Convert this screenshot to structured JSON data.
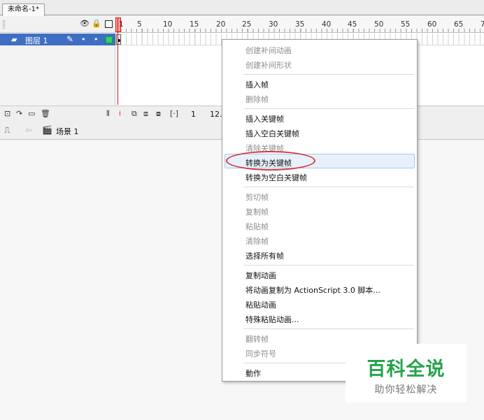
{
  "document_tab": {
    "label": "未命名-1*"
  },
  "timeline": {
    "ruler_numbers": [
      "1",
      "5",
      "10",
      "15",
      "20",
      "25",
      "30",
      "35",
      "40",
      "45",
      "50",
      "55",
      "60",
      "65",
      "7"
    ],
    "layer": {
      "name": "图层 1"
    },
    "bottom": {
      "frame": "1",
      "fps": "12."
    }
  },
  "editbar": {
    "scene": "场景 1"
  },
  "context_menu": {
    "items": [
      {
        "label": "创建补间动画",
        "enabled": false
      },
      {
        "label": "创建补间形状",
        "enabled": false
      },
      {
        "label": "插入帧",
        "enabled": true
      },
      {
        "label": "删除帧",
        "enabled": false
      },
      {
        "label": "插入关键帧",
        "enabled": true
      },
      {
        "label": "插入空白关键帧",
        "enabled": true
      },
      {
        "label": "清除关键帧",
        "enabled": false
      },
      {
        "label": "转换为关键帧",
        "enabled": true,
        "highlighted": true
      },
      {
        "label": "转换为空白关键帧",
        "enabled": true
      },
      {
        "label": "剪切帧",
        "enabled": false
      },
      {
        "label": "复制帧",
        "enabled": false
      },
      {
        "label": "粘贴帧",
        "enabled": false
      },
      {
        "label": "清除帧",
        "enabled": false
      },
      {
        "label": "选择所有帧",
        "enabled": true
      },
      {
        "label": "复制动画",
        "enabled": true
      },
      {
        "label": "将动画复制为 ActionScript 3.0 脚本...",
        "enabled": true
      },
      {
        "label": "粘贴动画",
        "enabled": true
      },
      {
        "label": "特殊粘贴动画...",
        "enabled": true
      },
      {
        "label": "翻转帧",
        "enabled": false
      },
      {
        "label": "同步符号",
        "enabled": false
      },
      {
        "label": "動作",
        "enabled": true
      }
    ]
  },
  "watermark": {
    "title": "百科全说",
    "subtitle": "助你轻松解决"
  },
  "colors": {
    "layer_selected": "#3f6fc3",
    "playhead": "#dd1111",
    "annotation": "#d63a3a",
    "watermark": "#25a34a"
  }
}
